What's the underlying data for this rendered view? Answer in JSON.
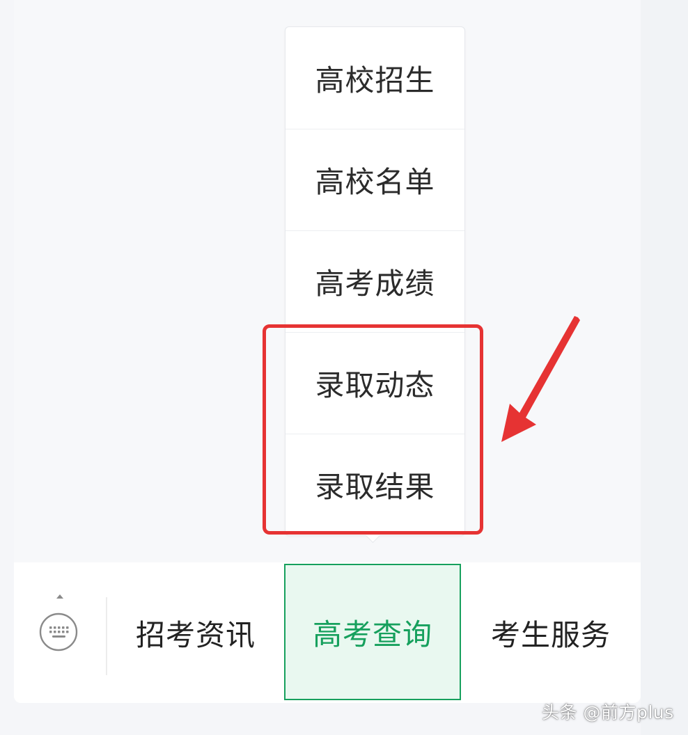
{
  "submenu": {
    "items": [
      {
        "label": "高校招生"
      },
      {
        "label": "高校名单"
      },
      {
        "label": "高考成绩"
      },
      {
        "label": "录取动态"
      },
      {
        "label": "录取结果"
      }
    ]
  },
  "menu_bar": {
    "keyboard_icon": "keyboard-icon",
    "tabs": [
      {
        "label": "招考资讯",
        "active": false
      },
      {
        "label": "高考查询",
        "active": true
      },
      {
        "label": "考生服务",
        "active": false
      }
    ]
  },
  "watermark": {
    "text": "头条 @前方plus"
  },
  "colors": {
    "accent": "#16a05d",
    "accent_bg": "#e9f8f0",
    "annotation": "#e63333"
  }
}
